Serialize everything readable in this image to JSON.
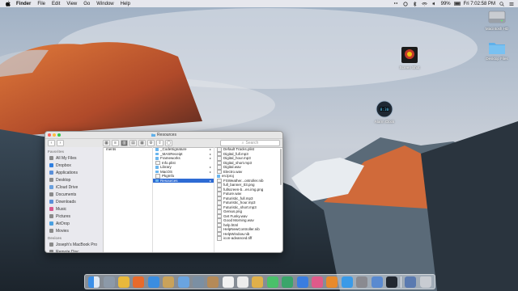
{
  "menubar": {
    "app": "Finder",
    "items": [
      "File",
      "Edit",
      "View",
      "Go",
      "Window",
      "Help"
    ],
    "battery": "99%",
    "clock": "Fri 7:02:58 PM"
  },
  "desktop": {
    "icons": [
      {
        "name": "Macintosh HD",
        "icon": "hard-drive-icon"
      },
      {
        "name": "Desktop Files",
        "icon": "folder-icon"
      },
      {
        "name": "Screen Shot",
        "icon": "app-thumbnail-icon"
      },
      {
        "name": "Alarm Clock",
        "icon": "alarm-clock-icon"
      }
    ]
  },
  "finder": {
    "title": "Resources",
    "search_placeholder": "Search",
    "sidebar": {
      "favorites_header": "Favorites",
      "favorites": [
        {
          "label": "All My Files",
          "icon": "all-files-icon",
          "color": "#8a8a8a"
        },
        {
          "label": "Dropbox",
          "icon": "dropbox-icon",
          "color": "#2f7fe0"
        },
        {
          "label": "Applications",
          "icon": "applications-icon",
          "color": "#5a8fd8"
        },
        {
          "label": "Desktop",
          "icon": "desktop-icon",
          "color": "#8a8a8a"
        },
        {
          "label": "iCloud Drive",
          "icon": "cloud-icon",
          "color": "#6aa0dd"
        },
        {
          "label": "Documents",
          "icon": "documents-icon",
          "color": "#8a8a8a"
        },
        {
          "label": "Downloads",
          "icon": "downloads-icon",
          "color": "#5a8fd8"
        },
        {
          "label": "Music",
          "icon": "music-icon",
          "color": "#d85a8f"
        },
        {
          "label": "Pictures",
          "icon": "pictures-icon",
          "color": "#8a8a8a"
        },
        {
          "label": "AirDrop",
          "icon": "airdrop-icon",
          "color": "#4aa0e0"
        },
        {
          "label": "Movies",
          "icon": "movies-icon",
          "color": "#8a8a8a"
        }
      ],
      "devices_header": "Devices",
      "devices": [
        {
          "label": "Joseph's MacBook Pro",
          "icon": "laptop-icon",
          "color": "#8a8a8a"
        },
        {
          "label": "Remote Disc",
          "icon": "disc-icon",
          "color": "#8a8a8a"
        }
      ]
    },
    "column1": [
      "ments"
    ],
    "column2": [
      {
        "name": "_CodeSignature",
        "folder": true,
        "arrow": true
      },
      {
        "name": "_MASReceipt",
        "folder": true,
        "arrow": true
      },
      {
        "name": "Frameworks",
        "folder": true,
        "arrow": true
      },
      {
        "name": "Info.plist",
        "folder": false,
        "arrow": false
      },
      {
        "name": "Library",
        "folder": true,
        "arrow": true
      },
      {
        "name": "MacOS",
        "folder": true,
        "arrow": true
      },
      {
        "name": "PkgInfo",
        "folder": false,
        "arrow": false
      },
      {
        "name": "Resources",
        "folder": true,
        "arrow": true,
        "selected": true
      }
    ],
    "column3": [
      "Default Tracks.plist",
      "Digital_full.mp3",
      "Digital_hour.mp3",
      "Digital_short.mp3",
      "Digital.wav",
      "Electro.wav",
      "en.lproj",
      "FSWeather...ontroller.nib",
      "full_banner_03.png",
      "fullscreen-b...en.img.png",
      "Future.wav",
      "Futuristic_full.mp3",
      "Futuristic_hour.mp3",
      "Futuristic_short.mp3",
      "Genius.png",
      "Get Funky.wav",
      "Good Morning.wav",
      "help.html",
      "HelpNewController.nib",
      "HelpWindow.nib",
      "icon-advanced.tiff"
    ]
  },
  "dock": {
    "apps": [
      {
        "name": "Finder",
        "icon": "finder-icon",
        "color": "#3b8fe8"
      },
      {
        "name": "Launchpad",
        "icon": "launchpad-icon",
        "color": "#8c99a8"
      },
      {
        "name": "Chrome",
        "icon": "chrome-icon",
        "color": "#e8b83b"
      },
      {
        "name": "Firefox",
        "icon": "firefox-icon",
        "color": "#e86a2b"
      },
      {
        "name": "Safari",
        "icon": "safari-icon",
        "color": "#3a8de0"
      },
      {
        "name": "Notes",
        "icon": "notes-icon",
        "color": "#c9a25a"
      },
      {
        "name": "Mail",
        "icon": "mail-icon",
        "color": "#6aa4e0"
      },
      {
        "name": "Stickies",
        "icon": "stickies-icon",
        "color": "#7b8fa3"
      },
      {
        "name": "Contacts",
        "icon": "contacts-icon",
        "color": "#b58a58"
      },
      {
        "name": "Calendar",
        "icon": "calendar-icon",
        "color": "#f2f2f2"
      },
      {
        "name": "Reminders",
        "icon": "reminders-icon",
        "color": "#ececec"
      },
      {
        "name": "Photos",
        "icon": "photos-icon",
        "color": "#e0b04a"
      },
      {
        "name": "Messages",
        "icon": "messages-icon",
        "color": "#4ac06a"
      },
      {
        "name": "Numbers",
        "icon": "numbers-icon",
        "color": "#3aa56a"
      },
      {
        "name": "Keynote",
        "icon": "keynote-icon",
        "color": "#3a7de0"
      },
      {
        "name": "iTunes",
        "icon": "itunes-icon",
        "color": "#e05a8a"
      },
      {
        "name": "iBooks",
        "icon": "ibooks-icon",
        "color": "#e88a2b"
      },
      {
        "name": "App Store",
        "icon": "app-store-icon",
        "color": "#3a9ae8"
      },
      {
        "name": "System Preferences",
        "icon": "gear-icon",
        "color": "#8a8a90"
      },
      {
        "name": "Preview",
        "icon": "preview-icon",
        "color": "#5a8ad0"
      },
      {
        "name": "Alarm Clock",
        "icon": "alarm-clock-icon",
        "color": "#222831"
      },
      {
        "name": "Downloads Stack",
        "icon": "downloads-stack-icon",
        "color": "#5a7ab0"
      },
      {
        "name": "Trash",
        "icon": "trash-icon",
        "color": "#c8ccd2"
      }
    ]
  }
}
